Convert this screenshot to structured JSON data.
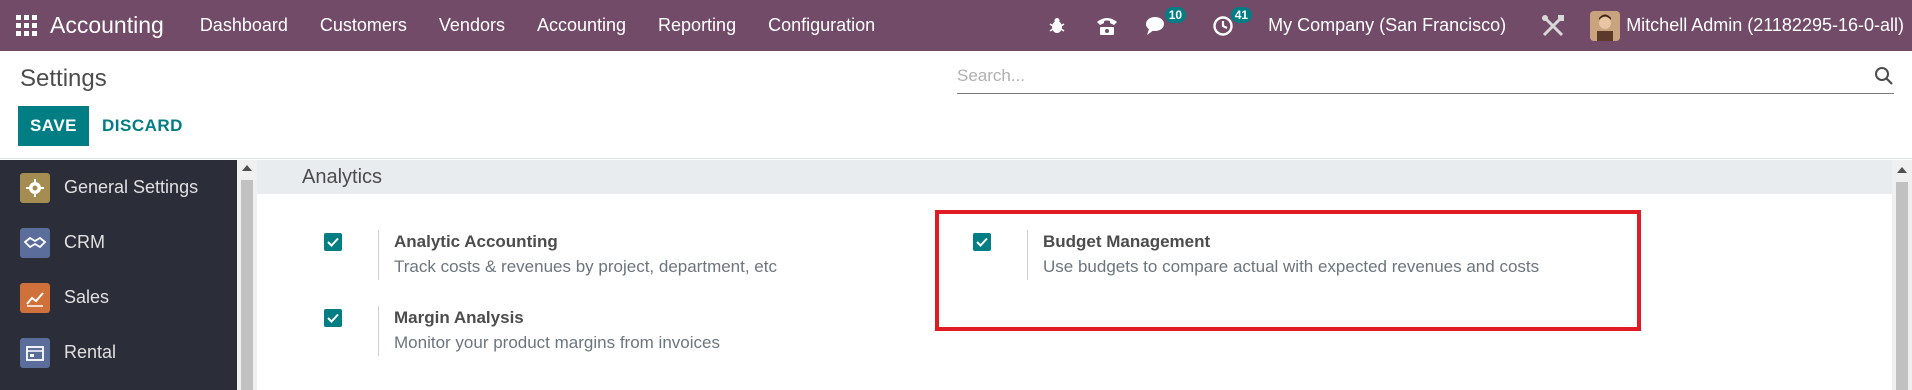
{
  "navbar": {
    "brand": "Accounting",
    "menu": [
      "Dashboard",
      "Customers",
      "Vendors",
      "Accounting",
      "Reporting",
      "Configuration"
    ],
    "messages_badge": "10",
    "activities_badge": "41",
    "company": "My Company (San Francisco)",
    "user": "Mitchell Admin (21182295-16-0-all)"
  },
  "control_panel": {
    "title": "Settings",
    "save_label": "SAVE",
    "discard_label": "DISCARD",
    "search_placeholder": "Search..."
  },
  "sidebar": {
    "items": [
      {
        "label": "General Settings",
        "icon": "gear-icon",
        "color": "#a58c50"
      },
      {
        "label": "CRM",
        "icon": "handshake-icon",
        "color": "#5b6d9a"
      },
      {
        "label": "Sales",
        "icon": "chart-icon",
        "color": "#d0713b"
      },
      {
        "label": "Rental",
        "icon": "rental-icon",
        "color": "#5b6d9a"
      }
    ]
  },
  "section": {
    "title": "Analytics"
  },
  "settings": [
    {
      "title": "Analytic Accounting",
      "desc": "Track costs & revenues by project, department, etc",
      "checked": true
    },
    {
      "title": "Budget Management",
      "desc": "Use budgets to compare actual with expected revenues and costs",
      "checked": true
    },
    {
      "title": "Margin Analysis",
      "desc": "Monitor your product margins from invoices",
      "checked": true
    }
  ],
  "colors": {
    "navbar": "#714b67",
    "primary": "#017e84",
    "highlight": "#e01b24",
    "sidebar": "#2b2d39"
  }
}
